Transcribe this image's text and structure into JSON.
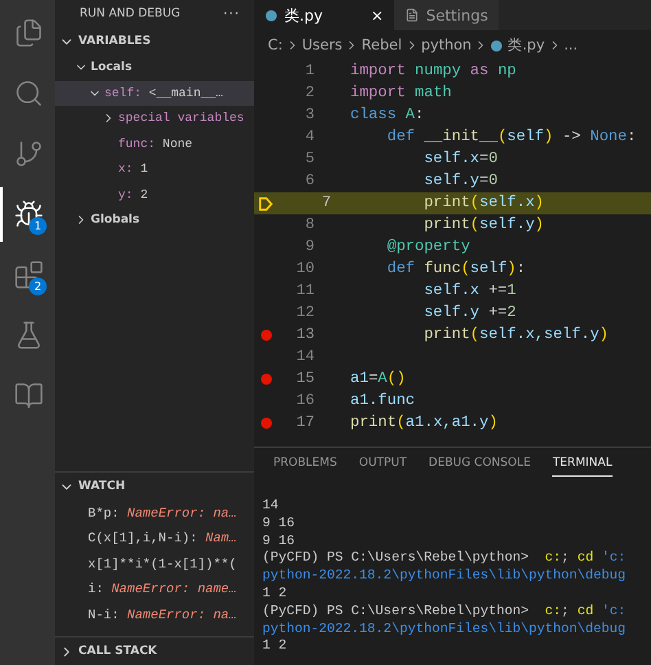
{
  "activity_bar": {
    "items": [
      {
        "kind": "files",
        "selected": false
      },
      {
        "kind": "search",
        "selected": false
      },
      {
        "kind": "source-control",
        "selected": false
      },
      {
        "kind": "run-debug",
        "selected": true,
        "badge": "1"
      },
      {
        "kind": "extensions",
        "selected": false,
        "badge": "2"
      },
      {
        "kind": "testing",
        "selected": false
      },
      {
        "kind": "notebook",
        "selected": false
      }
    ]
  },
  "sidebar": {
    "title": "RUN AND DEBUG",
    "menu": "···",
    "variables": {
      "title": "VARIABLES",
      "expanded": true,
      "items": [
        {
          "kind": "scope",
          "name": "Locals",
          "expanded": true,
          "selected": false,
          "children": [
            {
              "name": "self:",
              "value": "<__main__…",
              "expanded": true,
              "selected": true,
              "children": [
                {
                  "name": "special variables",
                  "expanded": false,
                  "selected": false
                },
                {
                  "name": "func:",
                  "value": "None",
                  "selected": false
                },
                {
                  "name": "x:",
                  "value": "1",
                  "selected": false
                },
                {
                  "name": "y:",
                  "value": "2",
                  "selected": false
                }
              ]
            }
          ]
        },
        {
          "kind": "scope",
          "name": "Globals",
          "expanded": false,
          "selected": false
        }
      ]
    },
    "watch": {
      "title": "WATCH",
      "expanded": true,
      "items": [
        {
          "expr": "B*p:",
          "value": "NameError: na…"
        },
        {
          "expr": "C(x[1],i,N-i):",
          "value": "Nam…"
        },
        {
          "expr": "x[1]**i*(1-x[1])**("
        },
        {
          "expr": "i:",
          "value": "NameError: name…"
        },
        {
          "expr": "N-i:",
          "value": "NameError: na…"
        }
      ]
    },
    "call_stack": {
      "title": "CALL STACK",
      "expanded": false
    }
  },
  "editor": {
    "tabs": [
      {
        "label": "类.py",
        "kind": "python",
        "selected": true,
        "close": "×"
      },
      {
        "label": "Settings",
        "kind": "settings",
        "selected": false
      }
    ],
    "breadcrumbs": [
      {
        "label": "C:",
        "kind": "text"
      },
      {
        "label": "Users",
        "kind": "text"
      },
      {
        "label": "Rebel",
        "kind": "text"
      },
      {
        "label": "python",
        "kind": "text"
      },
      {
        "label": "类.py",
        "kind": "python"
      },
      {
        "label": "...",
        "kind": "text"
      }
    ],
    "lines": [
      {
        "number": "1",
        "breakpoint": false,
        "current": false,
        "tokens": [
          {
            "kind": "kw",
            "text": "import"
          },
          {
            "kind": "mod",
            "text": " numpy"
          },
          {
            "kind": "kw",
            "text": " as"
          },
          {
            "kind": "mod",
            "text": " np"
          }
        ]
      },
      {
        "number": "2",
        "breakpoint": false,
        "current": false,
        "tokens": [
          {
            "kind": "kw",
            "text": "import"
          },
          {
            "kind": "mod",
            "text": " math"
          }
        ]
      },
      {
        "number": "3",
        "breakpoint": false,
        "current": false,
        "tokens": [
          {
            "kind": "def",
            "text": "class"
          },
          {
            "kind": "mod",
            "text": " A"
          },
          {
            "kind": "op",
            "text": ":"
          }
        ]
      },
      {
        "number": "4",
        "breakpoint": false,
        "current": false,
        "tokens": [
          {
            "kind": "def",
            "text": "    def"
          },
          {
            "kind": "fn",
            "text": " __init__"
          },
          {
            "kind": "br",
            "text": "("
          },
          {
            "kind": "var",
            "text": "self"
          },
          {
            "kind": "br",
            "text": ")"
          },
          {
            "kind": "op",
            "text": " ->"
          },
          {
            "kind": "def",
            "text": " None"
          },
          {
            "kind": "op",
            "text": ":"
          }
        ]
      },
      {
        "number": "5",
        "breakpoint": false,
        "current": false,
        "tokens": [
          {
            "kind": "var",
            "text": "        self.x"
          },
          {
            "kind": "op",
            "text": "="
          },
          {
            "kind": "num",
            "text": "0"
          }
        ]
      },
      {
        "number": "6",
        "breakpoint": false,
        "current": false,
        "tokens": [
          {
            "kind": "var",
            "text": "        self.y"
          },
          {
            "kind": "op",
            "text": "="
          },
          {
            "kind": "num",
            "text": "0"
          }
        ]
      },
      {
        "number": "7",
        "breakpoint": false,
        "current": true,
        "tokens": [
          {
            "kind": "fn",
            "text": "        print"
          },
          {
            "kind": "br",
            "text": "("
          },
          {
            "kind": "var",
            "text": "self.x"
          },
          {
            "kind": "br",
            "text": ")"
          }
        ]
      },
      {
        "number": "8",
        "breakpoint": false,
        "current": false,
        "tokens": [
          {
            "kind": "fn",
            "text": "        print"
          },
          {
            "kind": "br",
            "text": "("
          },
          {
            "kind": "var",
            "text": "self.y"
          },
          {
            "kind": "br",
            "text": ")"
          }
        ]
      },
      {
        "number": "9",
        "breakpoint": false,
        "current": false,
        "tokens": [
          {
            "kind": "mod",
            "text": "    @property"
          }
        ]
      },
      {
        "number": "10",
        "breakpoint": false,
        "current": false,
        "tokens": [
          {
            "kind": "def",
            "text": "    def"
          },
          {
            "kind": "fn",
            "text": " func"
          },
          {
            "kind": "br",
            "text": "("
          },
          {
            "kind": "var",
            "text": "self"
          },
          {
            "kind": "br",
            "text": ")"
          },
          {
            "kind": "op",
            "text": ":"
          }
        ]
      },
      {
        "number": "11",
        "breakpoint": false,
        "current": false,
        "tokens": [
          {
            "kind": "var",
            "text": "        self.x"
          },
          {
            "kind": "op",
            "text": " +="
          },
          {
            "kind": "num",
            "text": "1"
          }
        ]
      },
      {
        "number": "12",
        "breakpoint": false,
        "current": false,
        "tokens": [
          {
            "kind": "var",
            "text": "        self.y"
          },
          {
            "kind": "op",
            "text": " +="
          },
          {
            "kind": "num",
            "text": "2"
          }
        ]
      },
      {
        "number": "13",
        "breakpoint": true,
        "current": false,
        "tokens": [
          {
            "kind": "fn",
            "text": "        print"
          },
          {
            "kind": "br",
            "text": "("
          },
          {
            "kind": "var",
            "text": "self.x,self.y"
          },
          {
            "kind": "br",
            "text": ")"
          }
        ]
      },
      {
        "number": "14",
        "breakpoint": false,
        "current": false
      },
      {
        "number": "15",
        "breakpoint": true,
        "current": false,
        "tokens": [
          {
            "kind": "var",
            "text": "a1"
          },
          {
            "kind": "op",
            "text": "="
          },
          {
            "kind": "mod",
            "text": "A"
          },
          {
            "kind": "br",
            "text": "()"
          }
        ]
      },
      {
        "number": "16",
        "breakpoint": false,
        "current": false,
        "tokens": [
          {
            "kind": "var",
            "text": "a1.func"
          }
        ]
      },
      {
        "number": "17",
        "breakpoint": true,
        "current": false,
        "tokens": [
          {
            "kind": "fn",
            "text": "print"
          },
          {
            "kind": "br",
            "text": "("
          },
          {
            "kind": "var",
            "text": "a1.x,a1.y"
          },
          {
            "kind": "br",
            "text": ")"
          }
        ]
      }
    ]
  },
  "panel": {
    "tabs": [
      {
        "label": "PROBLEMS",
        "selected": false
      },
      {
        "label": "OUTPUT",
        "selected": false
      },
      {
        "label": "DEBUG CONSOLE",
        "selected": false
      },
      {
        "label": "TERMINAL",
        "selected": true
      }
    ],
    "terminal": [
      [
        {
          "kind": "plain",
          "text": "14"
        }
      ],
      [
        {
          "kind": "plain",
          "text": "9 16"
        }
      ],
      [
        {
          "kind": "plain",
          "text": "9 16"
        }
      ],
      [
        {
          "kind": "plain",
          "text": "(PyCFD) PS C:\\Users\\Rebel\\python>"
        },
        {
          "kind": "cmd",
          "text": "  c:"
        },
        {
          "kind": "plain",
          "text": ";"
        },
        {
          "kind": "cmd",
          "text": " cd"
        },
        {
          "kind": "str",
          "text": " 'c:"
        }
      ],
      [
        {
          "kind": "str",
          "text": "python-2022.18.2\\pythonFiles\\lib\\python\\debug"
        }
      ],
      [
        {
          "kind": "plain",
          "text": "1 2"
        }
      ],
      [
        {
          "kind": "plain",
          "text": "(PyCFD) PS C:\\Users\\Rebel\\python>"
        },
        {
          "kind": "cmd",
          "text": "  c:"
        },
        {
          "kind": "plain",
          "text": ";"
        },
        {
          "kind": "cmd",
          "text": " cd"
        },
        {
          "kind": "str",
          "text": " 'c:"
        }
      ],
      [
        {
          "kind": "str",
          "text": "python-2022.18.2\\pythonFiles\\lib\\python\\debug"
        }
      ],
      [
        {
          "kind": "plain",
          "text": "1 2"
        }
      ]
    ]
  }
}
